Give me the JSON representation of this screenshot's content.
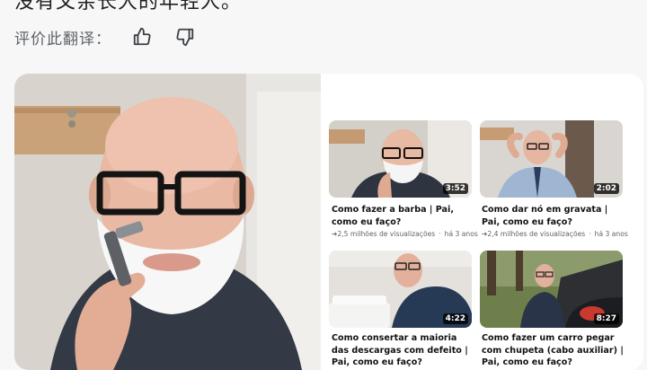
{
  "header": {
    "top_text": "没有父亲长大的年轻人。",
    "rate_label": "评价此翻译："
  },
  "hero": {
    "alt": ""
  },
  "videos": [
    {
      "title": "Como fazer a barba | Pai, como eu faço?",
      "duration": "3:52",
      "views": "2,5 milhões de visualizações",
      "age": "há 3 anos"
    },
    {
      "title": "Como dar nó em gravata | Pai, como eu faço?",
      "duration": "2:02",
      "views": "2,4 milhões de visualizações",
      "age": "há 3 anos"
    },
    {
      "title": "Como consertar a maioria das descargas com defeito | Pai, como eu faço?",
      "duration": "4:22",
      "views": "",
      "age": ""
    },
    {
      "title": "Como fazer um carro pegar com chupeta (cabo auxiliar) | Pai, como eu faço?",
      "duration": "8:27",
      "views": "",
      "age": ""
    }
  ],
  "icons": {
    "thumbs_up": "thumbs-up-icon",
    "thumbs_down": "thumbs-down-icon",
    "trend": "trending-arrow-icon"
  },
  "colors": {
    "background": "#f7f7f8",
    "card": "#ffffff",
    "text_muted": "#5f6368",
    "duration_bg": "#000000"
  }
}
